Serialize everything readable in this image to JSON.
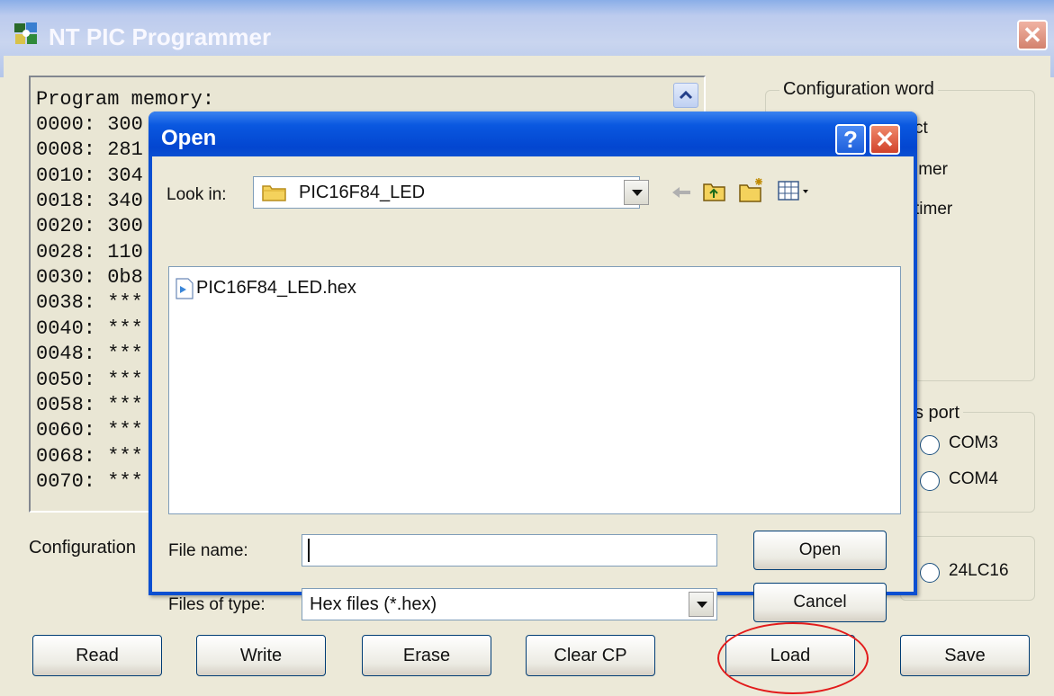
{
  "window": {
    "title": "NT PIC Programmer",
    "close_glyph": "✕"
  },
  "memory": {
    "title": "Program memory:",
    "lines": [
      "0000: 300",
      "0008: 281",
      "0010: 304",
      "0018: 340",
      "0020: 300",
      "0028: 110",
      "0030: 0b8",
      "0038: ***",
      "0040: ***",
      "0048: ***",
      "0050: ***",
      "0058: ***",
      "0060: ***",
      "0068: ***",
      "0070: ***"
    ]
  },
  "config_word": {
    "legend": "Configuration word",
    "items": [
      "ct",
      "imer",
      "timer"
    ]
  },
  "port": {
    "legend": "s port",
    "options": [
      "COM3",
      "COM4"
    ]
  },
  "eeprom": {
    "option": "24LC16"
  },
  "config_label": "Configuration",
  "buttons": {
    "read": "Read",
    "write": "Write",
    "erase": "Erase",
    "clear_cp": "Clear CP",
    "load": "Load",
    "save": "Save"
  },
  "dialog": {
    "title": "Open",
    "help_glyph": "?",
    "close_glyph": "✕",
    "look_in_label": "Look in:",
    "look_in_value": "PIC16F84_LED",
    "files": [
      "PIC16F84_LED.hex"
    ],
    "file_name_label": "File name:",
    "file_name_value": "",
    "files_of_type_label": "Files of type:",
    "files_of_type_value": "Hex files (*.hex)",
    "open_label": "Open",
    "cancel_label": "Cancel"
  },
  "colors": {
    "dialog_title_blue": "#0a58e0",
    "highlight_circle": "#e21b1b",
    "window_face": "#ece9d8"
  }
}
